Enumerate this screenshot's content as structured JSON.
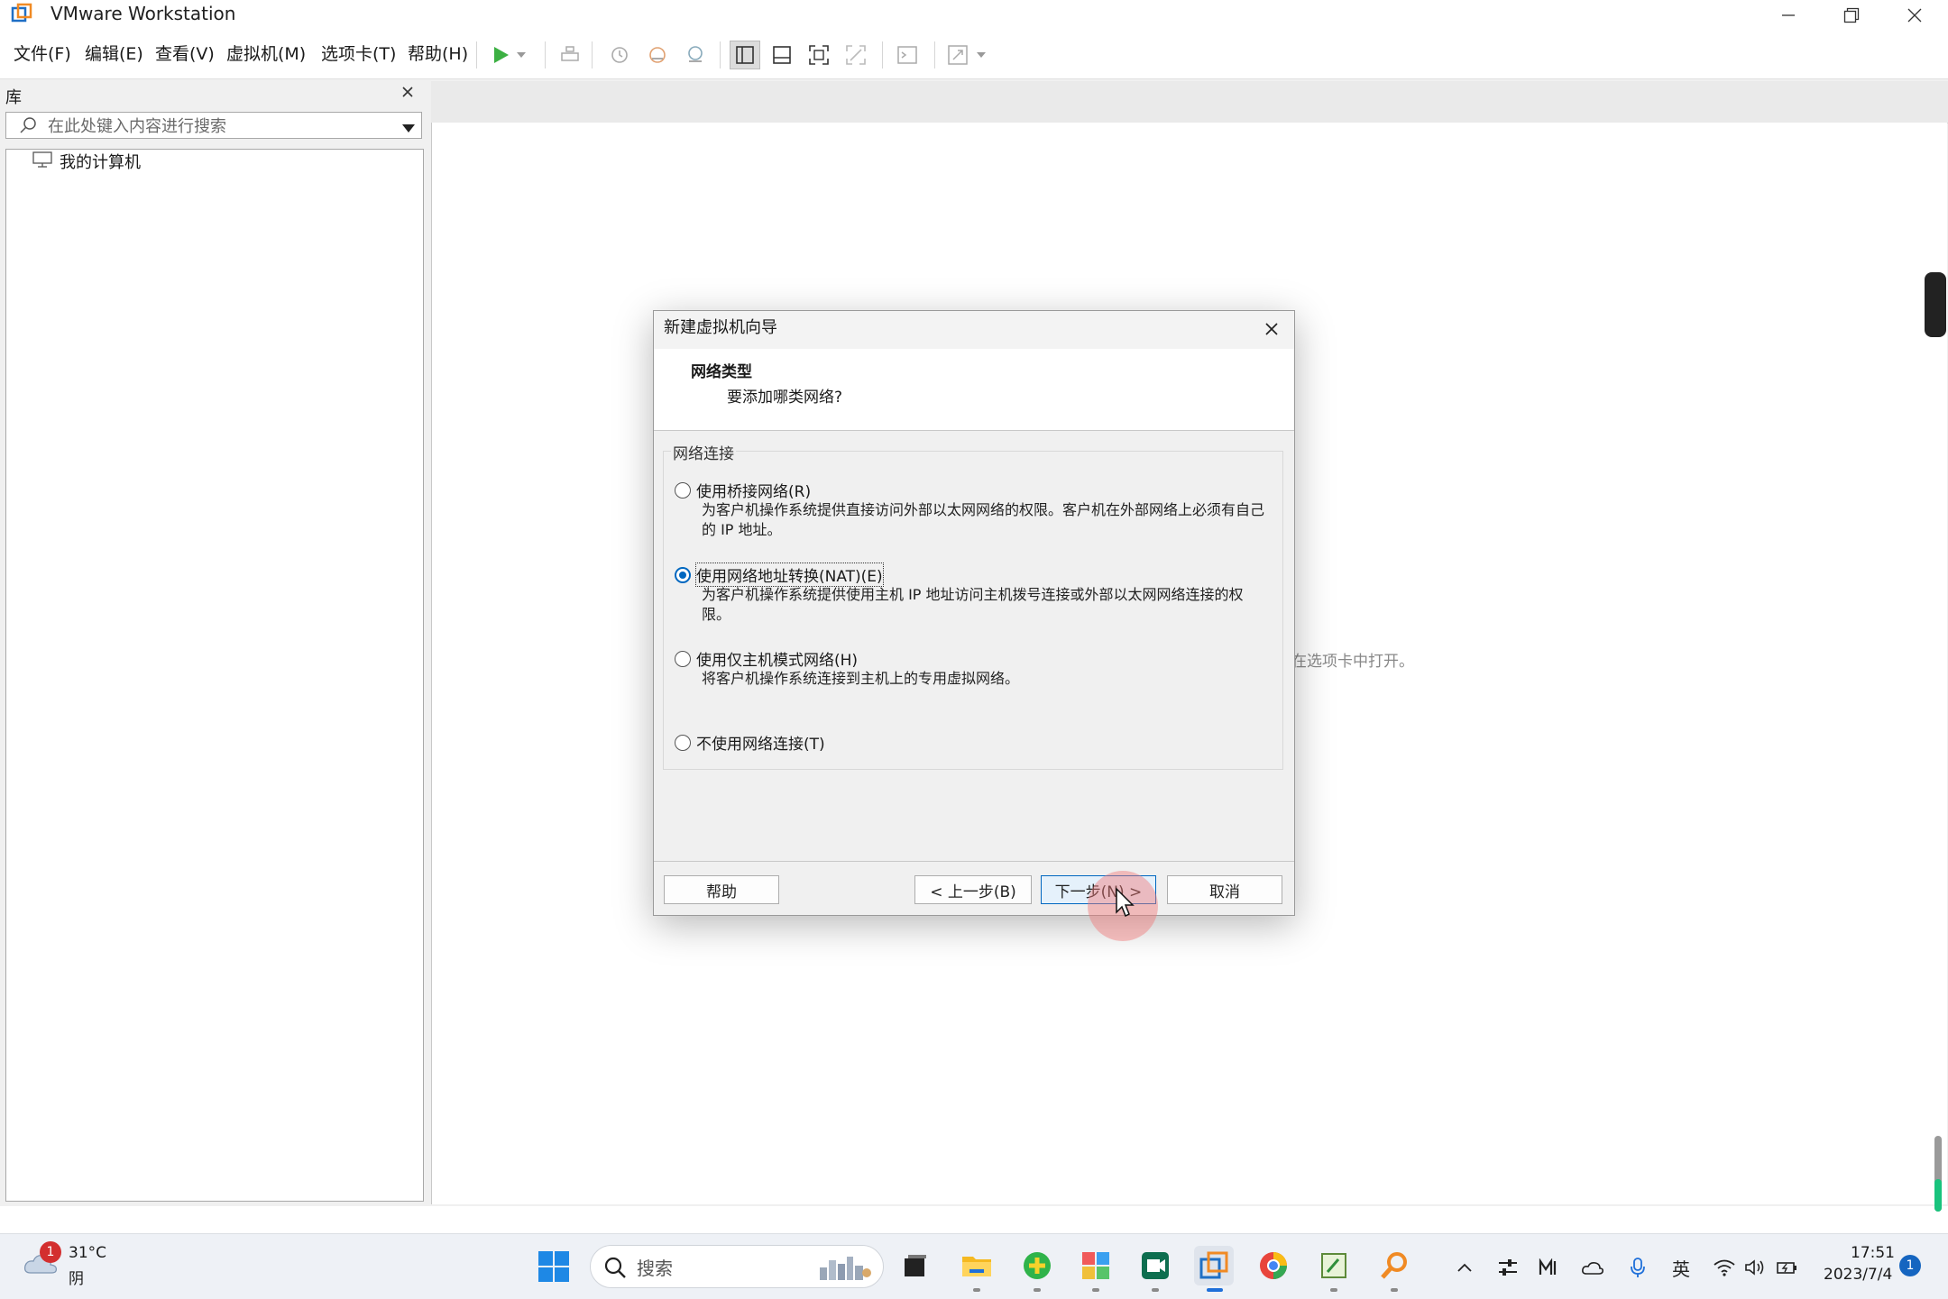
{
  "window": {
    "title": "VMware Workstation"
  },
  "menu": {
    "items": [
      "文件(F)",
      "编辑(E)",
      "查看(V)",
      "虚拟机(M)",
      "选项卡(T)",
      "帮助(H)"
    ]
  },
  "library": {
    "title": "库",
    "search_placeholder": "在此处键入内容进行搜索",
    "tree_item": "我的计算机"
  },
  "main": {
    "background_hint": "在选项卡中打开。"
  },
  "dialog": {
    "title": "新建虚拟机向导",
    "header_title": "网络类型",
    "header_subtitle": "要添加哪类网络?",
    "group_label": "网络连接",
    "options": [
      {
        "label": "使用桥接网络(R)",
        "desc": "为客户机操作系统提供直接访问外部以太网网络的权限。客户机在外部网络上必须有自己的 IP 地址。",
        "selected": false
      },
      {
        "label": "使用网络地址转换(NAT)(E)",
        "desc": "为客户机操作系统提供使用主机 IP 地址访问主机拨号连接或外部以太网网络连接的权限。",
        "selected": true
      },
      {
        "label": "使用仅主机模式网络(H)",
        "desc": "将客户机操作系统连接到主机上的专用虚拟网络。",
        "selected": false
      },
      {
        "label": "不使用网络连接(T)",
        "desc": "",
        "selected": false
      }
    ],
    "buttons": {
      "help": "帮助",
      "back": "< 上一步(B)",
      "next": "下一步(N) >",
      "cancel": "取消"
    }
  },
  "taskbar": {
    "weather": {
      "temp": "31°C",
      "condition": "阴",
      "badge": "1"
    },
    "search_label": "搜索",
    "tray": {
      "ime": "英"
    },
    "clock": {
      "time": "17:51",
      "date": "2023/7/4"
    },
    "notification_count": "1"
  },
  "colors": {
    "accent": "#0067c0",
    "play": "#3cb043",
    "selection_ring": "#f07878"
  }
}
